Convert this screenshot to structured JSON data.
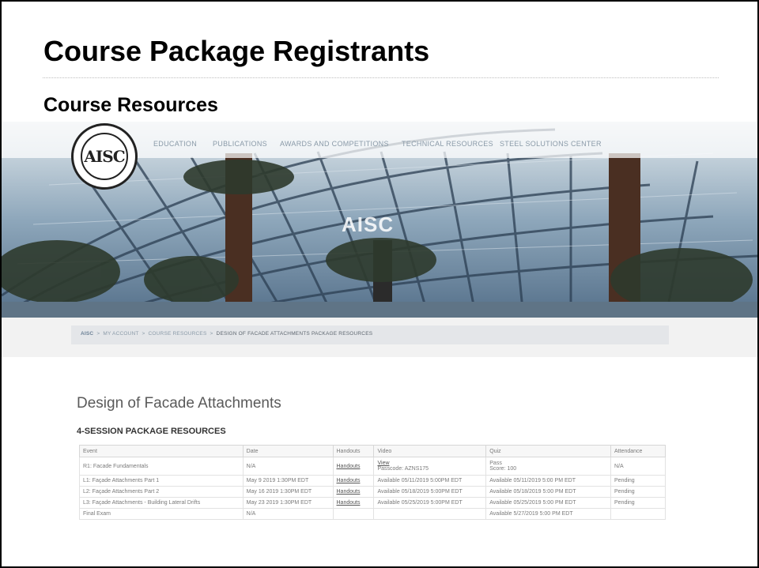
{
  "slide": {
    "title": "Course Package Registrants",
    "subtitle": "Course Resources"
  },
  "site": {
    "logo_text": "AISC",
    "hero_text": "AISC",
    "nav": [
      "EDUCATION",
      "PUBLICATIONS",
      "AWARDS AND COMPETITIONS",
      "TECHNICAL RESOURCES",
      "STEEL SOLUTIONS CENTER"
    ],
    "breadcrumb": [
      "AISC",
      "MY ACCOUNT",
      "COURSE RESOURCES",
      "DESIGN OF FACADE ATTACHMENTS PACKAGE RESOURCES"
    ]
  },
  "page": {
    "course_title": "Design of Facade Attachments",
    "package_heading": "4-SESSION PACKAGE RESOURCES",
    "columns": [
      "Event",
      "Date",
      "Handouts",
      "Video",
      "Quiz",
      "Attendance"
    ],
    "rows": [
      {
        "event": "R1: Facade Fundamentals",
        "date": "N/A",
        "handouts": "Handouts",
        "video_link": "View",
        "video": "Passcode: AZNS175",
        "quiz_a": "Pass",
        "quiz_b": "Score: 100",
        "attendance": "N/A"
      },
      {
        "event": "L1: Façade Attachments Part 1",
        "date": "May 9 2019 1:30PM EDT",
        "handouts": "Handouts",
        "video": "Available 05/11/2019 5:00PM EDT",
        "quiz": "Available 05/11/2019 5:00 PM EDT",
        "attendance": "Pending"
      },
      {
        "event": "L2: Façade Attachments Part 2",
        "date": "May 16 2019 1:30PM EDT",
        "handouts": "Handouts",
        "video": "Available 05/18/2019 5:00PM EDT",
        "quiz": "Available 05/18/2019 5:00 PM EDT",
        "attendance": "Pending"
      },
      {
        "event": "L3: Façade Attachments - Building Lateral Drifts",
        "date": "May 23 2019 1:30PM EDT",
        "handouts": "Handouts",
        "video": "Available 05/25/2019 5:00PM EDT",
        "quiz": "Available 05/25/2019 5:00 PM EDT",
        "attendance": "Pending"
      },
      {
        "event": "Final Exam",
        "date": "N/A",
        "handouts": "",
        "video": "",
        "quiz": "Available 5/27/2019 5:00 PM EDT",
        "attendance": ""
      }
    ]
  }
}
